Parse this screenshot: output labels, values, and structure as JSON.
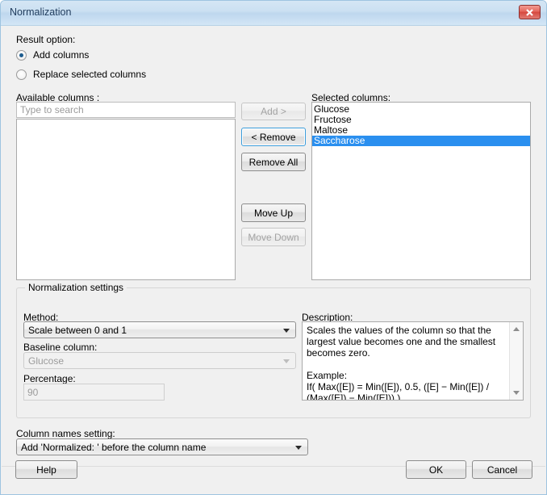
{
  "window": {
    "title": "Normalization",
    "close_icon": "close-x-icon"
  },
  "result_option": {
    "label": "Result option:",
    "options": [
      {
        "label": "Add columns",
        "selected": true
      },
      {
        "label": "Replace selected columns",
        "selected": false
      }
    ]
  },
  "available_columns": {
    "label": "Available columns :",
    "search_placeholder": "Type to search",
    "search_value": "",
    "items": []
  },
  "transfer_buttons": [
    {
      "label": "Add >",
      "enabled": false,
      "focused": false
    },
    {
      "label": "< Remove",
      "enabled": true,
      "focused": true
    },
    {
      "label": "Remove All",
      "enabled": true,
      "focused": false
    },
    {
      "label": "Move Up",
      "enabled": true,
      "focused": false
    },
    {
      "label": "Move Down",
      "enabled": false,
      "focused": false
    }
  ],
  "selected_columns": {
    "label": "Selected columns:",
    "items": [
      {
        "label": "Glucose",
        "selected": false
      },
      {
        "label": "Fructose",
        "selected": false
      },
      {
        "label": "Maltose",
        "selected": false
      },
      {
        "label": "Saccharose",
        "selected": true
      }
    ]
  },
  "settings": {
    "group_title": "Normalization settings",
    "method_label": "Method:",
    "method_value": "Scale between 0 and 1",
    "baseline_label": "Baseline column:",
    "baseline_value": "Glucose",
    "baseline_enabled": false,
    "percentage_label": "Percentage:",
    "percentage_value": "90",
    "percentage_enabled": false,
    "description_label": "Description:",
    "description_text": "Scales the values of the column so that the largest value becomes one and the smallest becomes zero.\n\nExample:\nIf( Max([E]) = Min([E]), 0.5, ([E] − Min([E]) / (Max([E]) − Min([E])) )"
  },
  "column_names": {
    "label": "Column names setting:",
    "value": "Add 'Normalized: ' before the column name"
  },
  "footer": {
    "help_label": "Help",
    "ok_label": "OK",
    "cancel_label": "Cancel"
  },
  "colors": {
    "accent": "#2a8fef",
    "titlebar": "#cbe0f2",
    "close_red": "#d5483f",
    "focus_ring": "#3c9ddb"
  }
}
